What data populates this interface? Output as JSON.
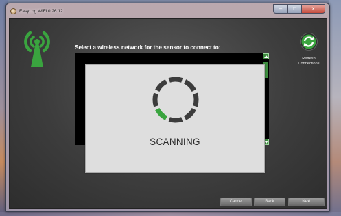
{
  "window": {
    "title": "EasyLog WiFi 0.26.12",
    "controls": {
      "minimize": "–",
      "maximize": "□",
      "close": "x"
    }
  },
  "icons": {
    "app": "easylog-app-icon",
    "wifi": "wifi-antenna-icon",
    "refresh": "refresh-arrows-icon",
    "spinner": "loading-spinner-icon"
  },
  "main": {
    "instruction": "Select a wireless network for the sensor to connect to:",
    "network_list": []
  },
  "refresh": {
    "label_line1": "Refresh",
    "label_line2": "Connections"
  },
  "scanning": {
    "status": "SCANNING",
    "segments_total": 8,
    "segments_highlighted": 1
  },
  "buttons": {
    "cancel": "Cancel",
    "back": "Back",
    "next": "Next"
  },
  "colors": {
    "accent_green": "#3aa43f",
    "panel_bg": "#3d3d3d",
    "modal_bg": "#dedede",
    "spinner_gray": "#3c3c3c"
  }
}
